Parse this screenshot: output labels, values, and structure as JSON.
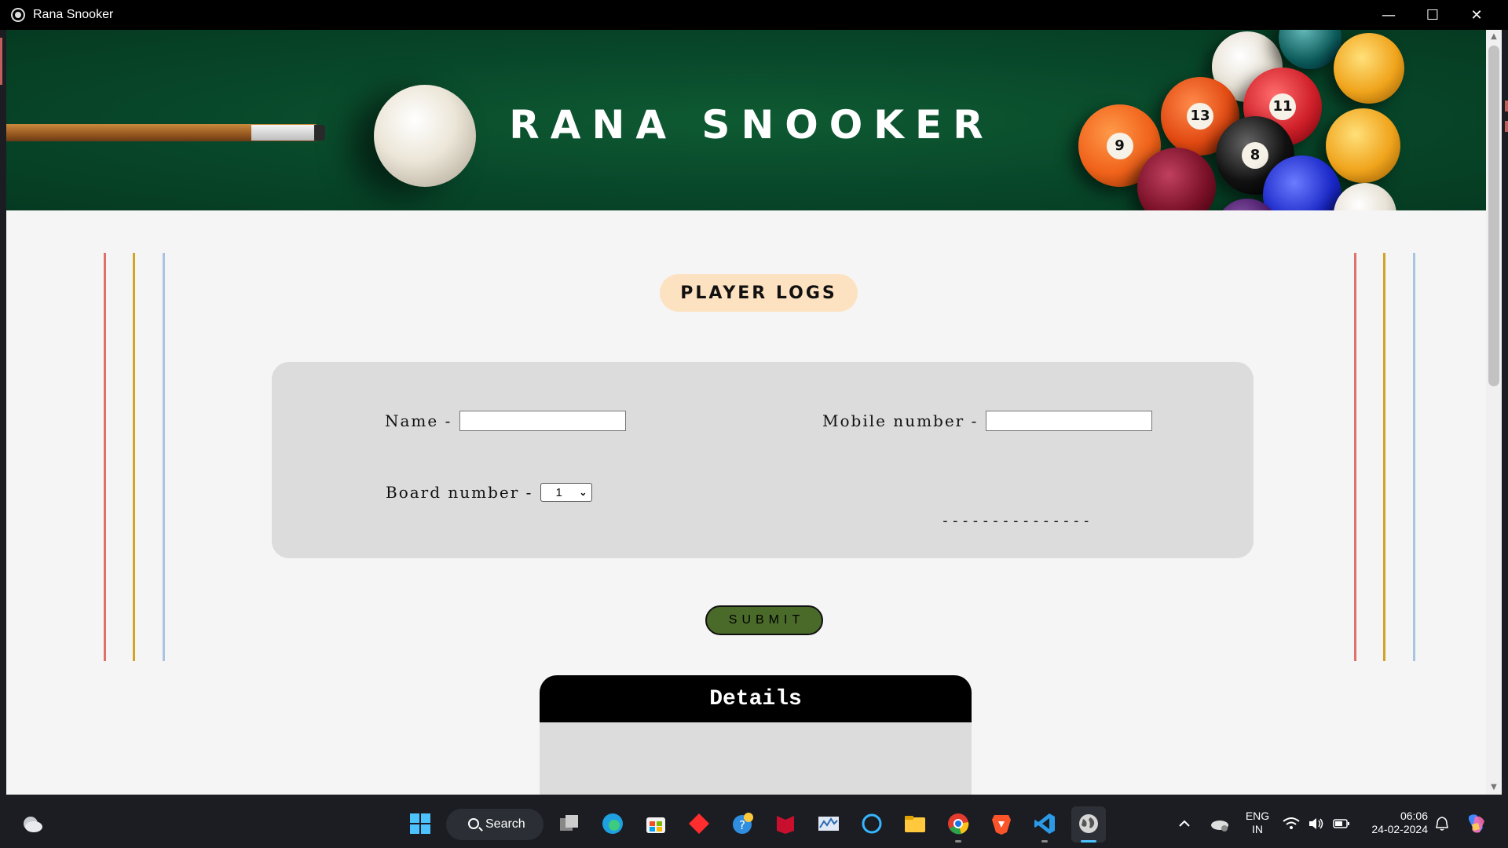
{
  "window": {
    "title": "Rana Snooker",
    "controls": {
      "minimize": "—",
      "maximize": "☐",
      "close": "✕"
    }
  },
  "banner": {
    "title": "RANA SNOOKER",
    "ball_numbers": [
      "13",
      "11",
      "8",
      "9"
    ]
  },
  "section": {
    "title": "PLAYER LOGS"
  },
  "form": {
    "name_label": "Name -",
    "name_value": "",
    "mobile_label": "Mobile number -",
    "mobile_value": "",
    "board_label": "Board number -",
    "board_selected": "1",
    "placeholder_dashes": "---------------"
  },
  "submit_label": "SUBMIT",
  "details": {
    "title": "Details"
  },
  "colors": {
    "banner_green": "#08472a",
    "pill": "#fde2c1",
    "submit": "#4a6a2a",
    "line_red": "#e0706a",
    "line_gold": "#d3a326",
    "line_blue": "#a8c4e0"
  },
  "taskbar": {
    "search_label": "Search",
    "apps": [
      "weather-icon",
      "start-icon",
      "task-view-icon",
      "edge-icon",
      "store-icon",
      "office-icon",
      "help-icon",
      "mcafee-icon",
      "monitor-icon",
      "cortana-icon",
      "file-explorer-icon",
      "chrome-icon",
      "brave-icon",
      "vscode-icon",
      "app-globe-icon"
    ],
    "language": "ENG",
    "region": "IN",
    "time": "06:06",
    "date": "24-02-2024"
  }
}
